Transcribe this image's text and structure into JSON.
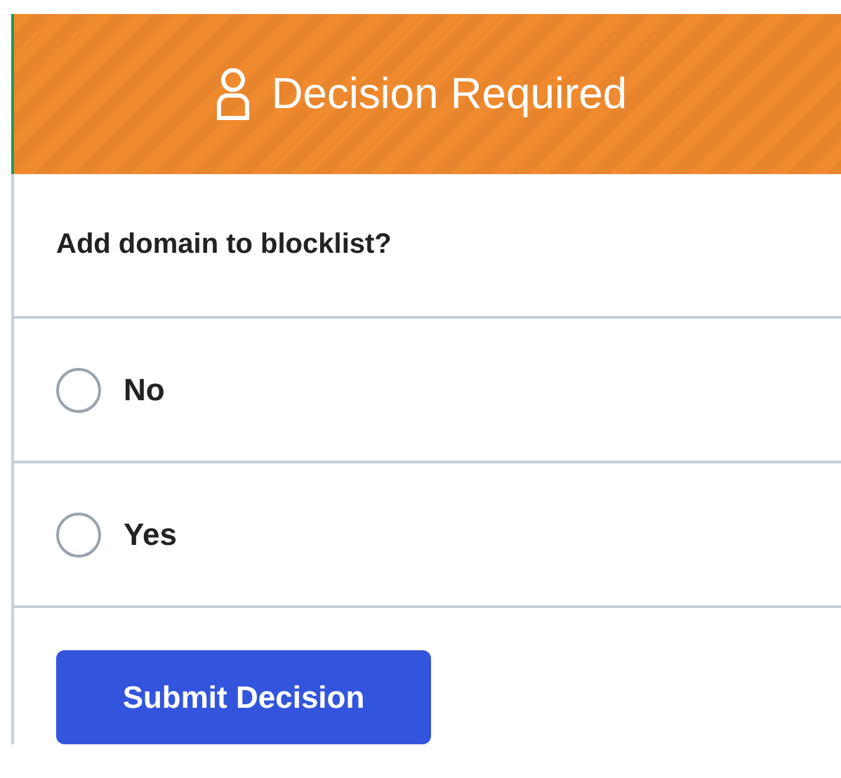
{
  "header": {
    "title": "Decision Required"
  },
  "question": "Add domain to blocklist?",
  "options": [
    {
      "label": "No",
      "selected": false
    },
    {
      "label": "Yes",
      "selected": false
    }
  ],
  "submit_button": "Submit Decision"
}
